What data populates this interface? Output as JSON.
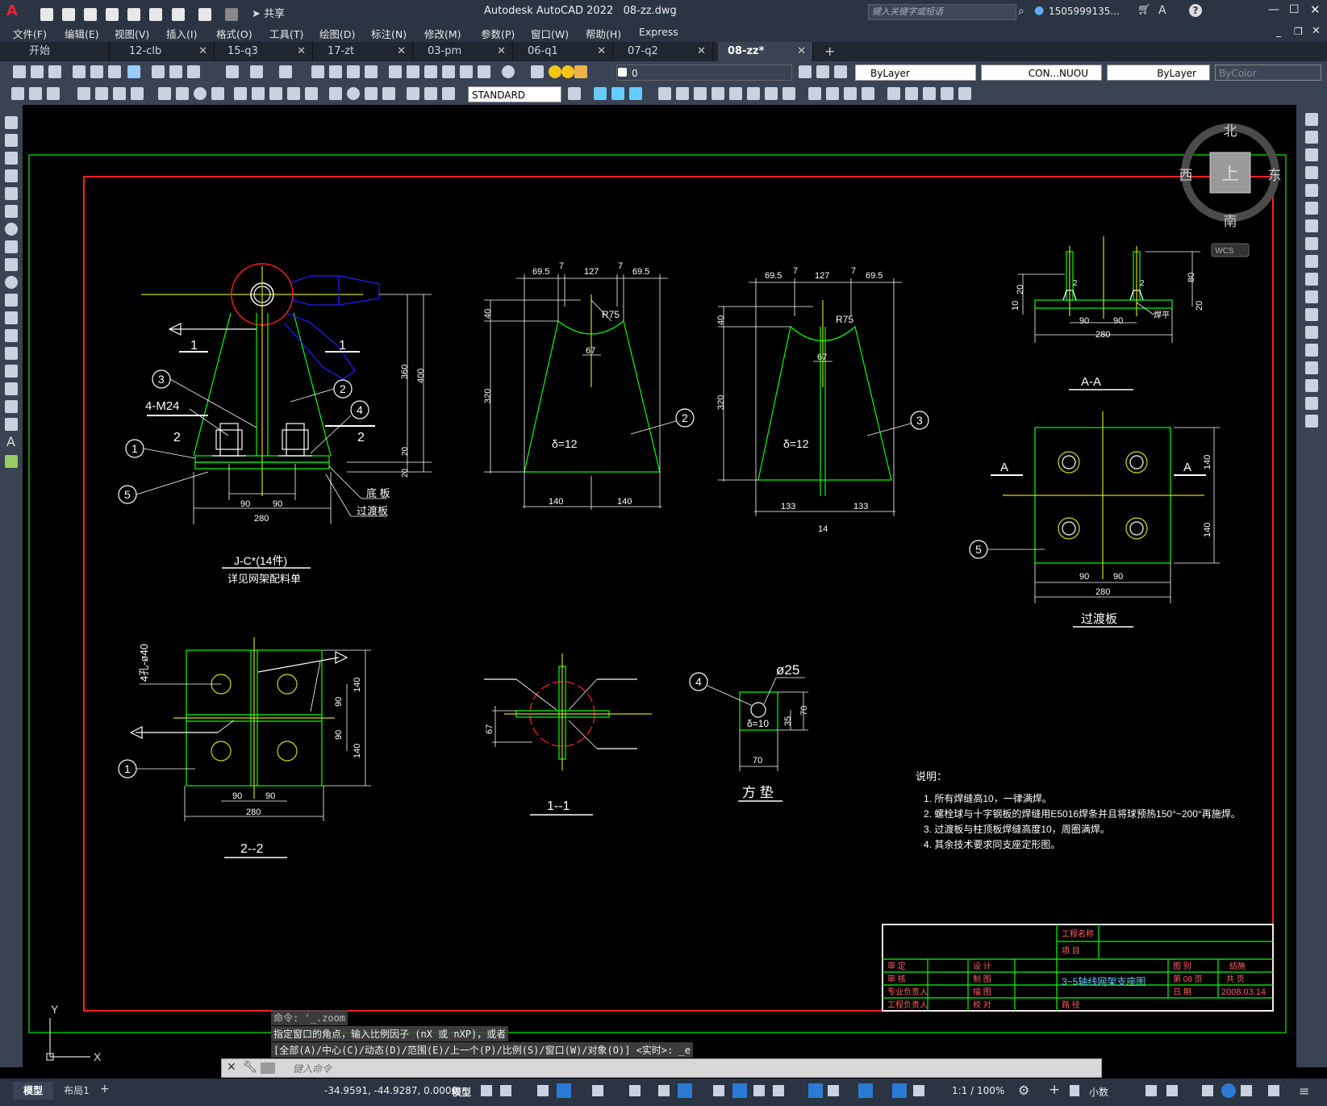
{
  "app": {
    "title": "Autodesk AutoCAD 2022",
    "filename": "08-zz.dwg",
    "share_label": "共享",
    "search_placeholder": "键入关键字或短语",
    "user": "1505999135...",
    "accent_color": "#c8102e"
  },
  "menu": [
    "文件(F)",
    "编辑(E)",
    "视图(V)",
    "插入(I)",
    "格式(O)",
    "工具(T)",
    "绘图(D)",
    "标注(N)",
    "修改(M)",
    "参数(P)",
    "窗口(W)",
    "帮助(H)",
    "Express"
  ],
  "tabs": [
    {
      "label": "开始"
    },
    {
      "label": "12-clb"
    },
    {
      "label": "15-q3"
    },
    {
      "label": "17-zt"
    },
    {
      "label": "03-pm"
    },
    {
      "label": "06-q1"
    },
    {
      "label": "07-q2"
    },
    {
      "label": "08-zz*",
      "active": true
    }
  ],
  "toolbar": {
    "layer_value": "0",
    "color_value": "ByLayer",
    "linetype_value": "CON...NUOU",
    "lineweight_value": "ByLayer",
    "plotstyle_value": "ByColor",
    "textstyle_value": "STANDARD"
  },
  "viewcube": {
    "north": "北",
    "south": "南",
    "east": "东",
    "west": "西",
    "top": "上",
    "wcs": "WCS"
  },
  "command": {
    "history1": "命令: '_.zoom",
    "history2": "指定窗口的角点，输入比例因子 (nX 或 nXP)，或者",
    "history3": "[全部(A)/中心(C)/动态(D)/范围(E)/上一个(P)/比例(S)/窗口(W)/对象(O)] <实时>: _e",
    "placeholder": "键入命令"
  },
  "layout_tabs": [
    "模型",
    "布局1"
  ],
  "status": {
    "coords": "-34.9591, -44.9287, 0.0000",
    "model_label": "模型",
    "scale": "1:1 / 100%",
    "units": "小数"
  },
  "drawing": {
    "detail_main_title": "J-C*(14件)",
    "detail_main_sub": "详见网架配料单",
    "label_4m24": "4-M24",
    "label_bottom_plate": "底 板",
    "label_transition_plate": "过渡板",
    "section_aa": "A-A",
    "section_22": "2--2",
    "section_11": "1--1",
    "transition_title": "过渡板",
    "square_pad_title": "方 垫",
    "phi25": "ø25",
    "holes_label": "4孔-ø40",
    "delta12": "δ=12",
    "delta10": "δ=10",
    "weld_note": "焊平",
    "notes_title": "说明：",
    "notes": [
      "1. 所有焊缝高10，一律满焊。",
      "2. 螺栓球与十字钢板的焊缝用E5016焊条并且将球预热150°~200°再施焊。",
      "3. 过渡板与柱顶板焊缝高度10，周圈满焊。",
      "4. 其余技术要求同支座定形图。"
    ],
    "dims": {
      "d695": "69.5",
      "d7": "7",
      "d127": "127",
      "d40": "40",
      "d320": "320",
      "d140": "140",
      "d67": "67",
      "dR75": "R75",
      "d133": "133",
      "d14": "14",
      "d90": "90",
      "d280": "280",
      "d360": "360",
      "d400": "400",
      "d20": "20",
      "d80": "80",
      "d10": "10",
      "d70": "70",
      "d35": "35"
    },
    "title_block": {
      "project_name": "工程名称",
      "project": "项 目",
      "drawing_title": "3~5轴线网架支座图",
      "rows_left": [
        "审 定",
        "审 核",
        "专业负责人",
        "工程负责人"
      ],
      "rows_mid": [
        "设 计",
        "制 图",
        "描 图",
        "校 对"
      ],
      "drawing_no_label": "图 别",
      "drawing_no_value": "结施",
      "sheet_label": "第 08 页",
      "total_label": "共 页",
      "date_label": "日 期",
      "date_value": "2008.03.14",
      "path_label": "路 径"
    }
  }
}
